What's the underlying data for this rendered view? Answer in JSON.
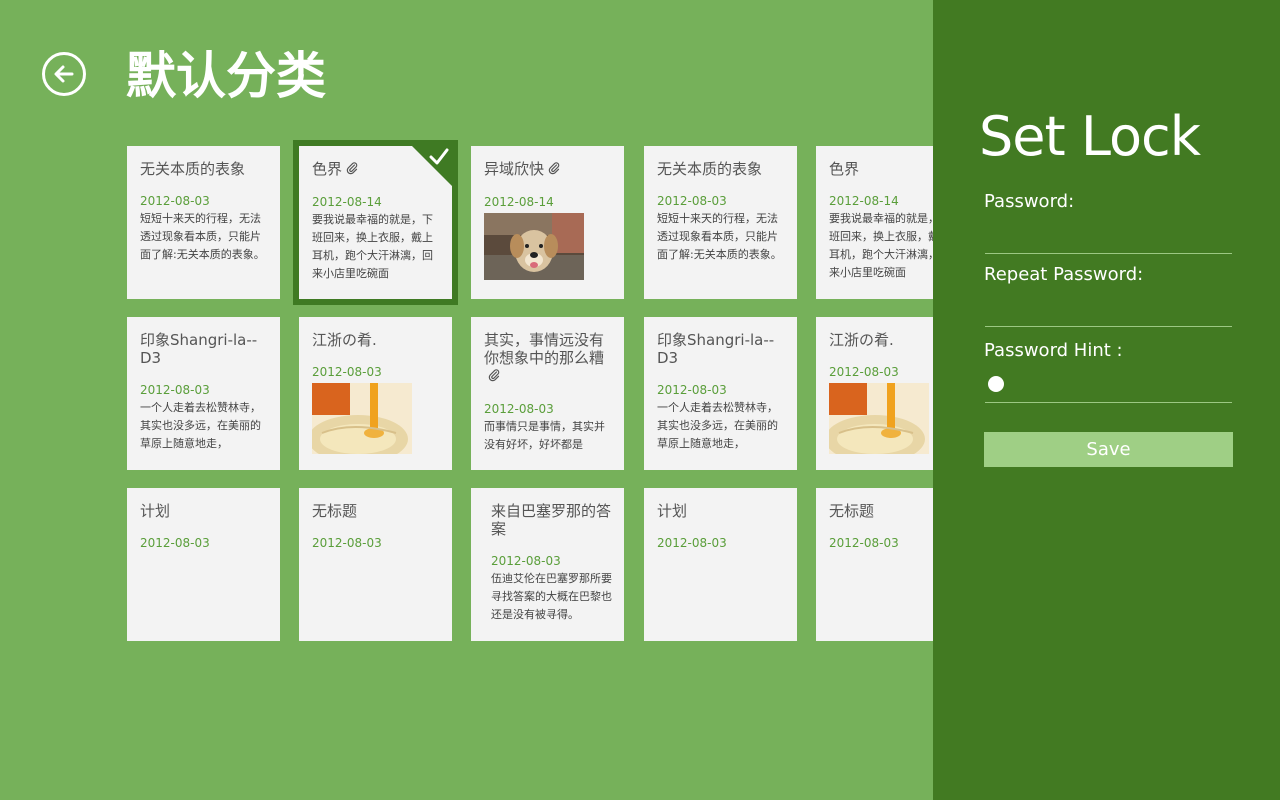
{
  "header": {
    "title": "默认分类",
    "back_icon": "back-arrow-icon"
  },
  "colors": {
    "background": "#76b15a",
    "panel": "#427a22",
    "card": "#f3f3f3",
    "date": "#5a9e3a",
    "save_button": "#9fcf85"
  },
  "cards": [
    {
      "title": "无关本质的表象",
      "date": "2012-08-03",
      "text": "短短十来天的行程，无法透过现象看本质，只能片面了解:无关本质的表象。",
      "attachment": false,
      "image": null,
      "selected": false
    },
    {
      "title": "色界",
      "date": "2012-08-14",
      "text": "要我说最幸福的就是，下班回来，换上衣服，戴上耳机，跑个大汗淋漓，回来小店里吃碗面",
      "attachment": true,
      "image": null,
      "selected": true
    },
    {
      "title": "异域欣快",
      "date": "2012-08-14",
      "text": "",
      "attachment": true,
      "image": "dog-photo",
      "selected": false
    },
    {
      "title": "无关本质的表象",
      "date": "2012-08-03",
      "text": "短短十来天的行程，无法透过现象看本质，只能片面了解:无关本质的表象。",
      "attachment": false,
      "image": null,
      "selected": false
    },
    {
      "title": "色界",
      "date": "2012-08-14",
      "text": "要我说最幸福的就是，下班回来，换上衣服，戴上耳机，跑个大汗淋漓，回来小店里吃碗面",
      "attachment": false,
      "image": null,
      "selected": false
    },
    {
      "title": "印象Shangri-la--D3",
      "date": "2012-08-03",
      "text": "一个人走着去松赞林寺，其实也没多远，在美丽的草原上随意地走，",
      "attachment": false,
      "image": null,
      "selected": false
    },
    {
      "title": "江浙の肴.",
      "date": "2012-08-03",
      "text": "",
      "attachment": false,
      "image": "food-photo",
      "selected": false
    },
    {
      "title": "其实，事情远没有你想象中的那么糟",
      "date": "2012-08-03",
      "text": "而事情只是事情，其实并没有好坏，好坏都是",
      "attachment": true,
      "image": null,
      "selected": false
    },
    {
      "title": "印象Shangri-la--D3",
      "date": "2012-08-03",
      "text": "一个人走着去松赞林寺，其实也没多远，在美丽的草原上随意地走，",
      "attachment": false,
      "image": null,
      "selected": false
    },
    {
      "title": "江浙の肴.",
      "date": "2012-08-03",
      "text": "",
      "attachment": false,
      "image": "food-photo",
      "selected": false
    },
    {
      "title": "计划",
      "date": "2012-08-03",
      "text": "",
      "attachment": false,
      "image": null,
      "selected": false
    },
    {
      "title": "无标题",
      "date": "2012-08-03",
      "text": "",
      "attachment": false,
      "image": null,
      "selected": false
    },
    {
      "title": "来自巴塞罗那的答案",
      "date": "2012-08-03",
      "text": "伍迪艾伦在巴塞罗那所要寻找答案的大概在巴黎也还是没有被寻得。",
      "attachment": false,
      "image": null,
      "selected": false
    },
    {
      "title": "计划",
      "date": "2012-08-03",
      "text": "",
      "attachment": false,
      "image": null,
      "selected": false
    },
    {
      "title": "无标题",
      "date": "2012-08-03",
      "text": "",
      "attachment": false,
      "image": null,
      "selected": false
    }
  ],
  "panel": {
    "title": "Set Lock",
    "password_label": "Password:",
    "password_value": "",
    "repeat_label": "Repeat Password:",
    "repeat_value": "",
    "hint_label": "Password Hint :",
    "hint_value": "",
    "save_label": "Save"
  }
}
